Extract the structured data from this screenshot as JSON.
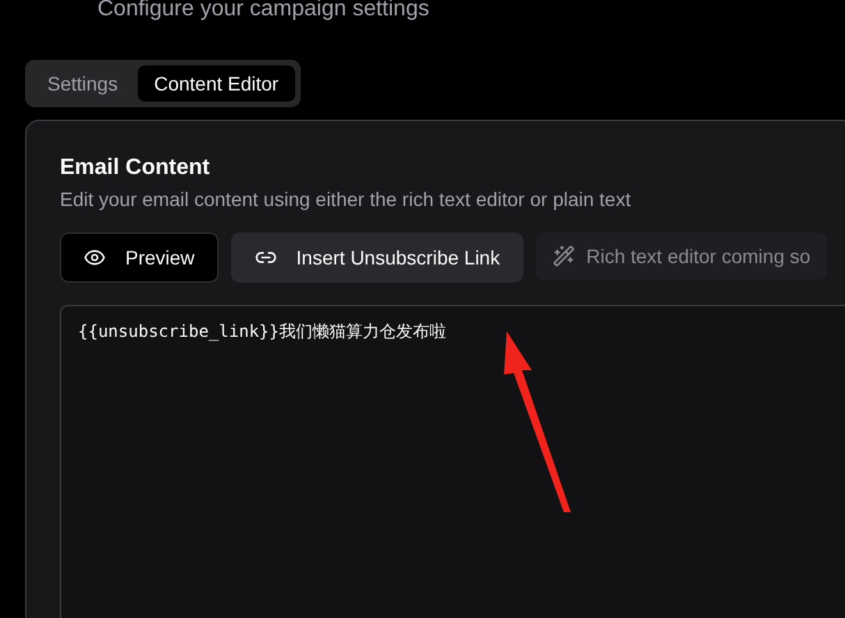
{
  "header": {
    "subtitle": "Configure your campaign settings"
  },
  "tabs": [
    {
      "label": "Settings",
      "selected": false
    },
    {
      "label": "Content Editor",
      "selected": true
    }
  ],
  "card": {
    "title": "Email Content",
    "description": "Edit your email content using either the rich text editor or plain text",
    "toolbar": [
      {
        "kind": "button",
        "label": "Preview"
      },
      {
        "kind": "button",
        "label": "Insert Unsubscribe Link"
      },
      {
        "kind": "note",
        "label": "Rich text editor coming so"
      }
    ],
    "editor": {
      "value": "{{unsubscribe_link}}我们懒猫算力仓发布啦"
    }
  }
}
